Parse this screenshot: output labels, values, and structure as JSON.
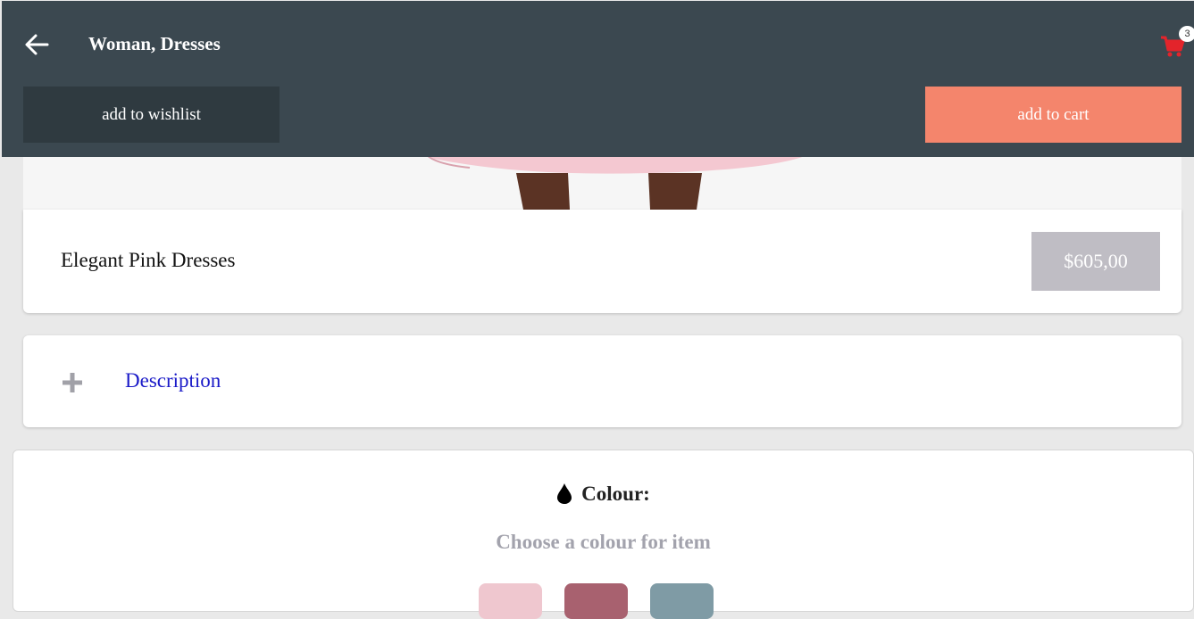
{
  "header": {
    "title": "Woman, Dresses",
    "cart_count": "3",
    "wishlist_label": "add to wishlist",
    "add_to_cart_label": "add to cart",
    "colors": {
      "background": "#3b4850",
      "wishlist_bg": "#2f3a40",
      "cart_btn_bg": "#f4856c",
      "cart_icon": "#e3242b"
    }
  },
  "product": {
    "name": "Elegant Pink Dresses",
    "price": "$605,00"
  },
  "description": {
    "label": "Description"
  },
  "colour": {
    "heading": "Colour:",
    "subtitle": "Choose a colour for item",
    "swatches": [
      "#efc7cf",
      "#a8616f",
      "#7f9ba5"
    ]
  }
}
